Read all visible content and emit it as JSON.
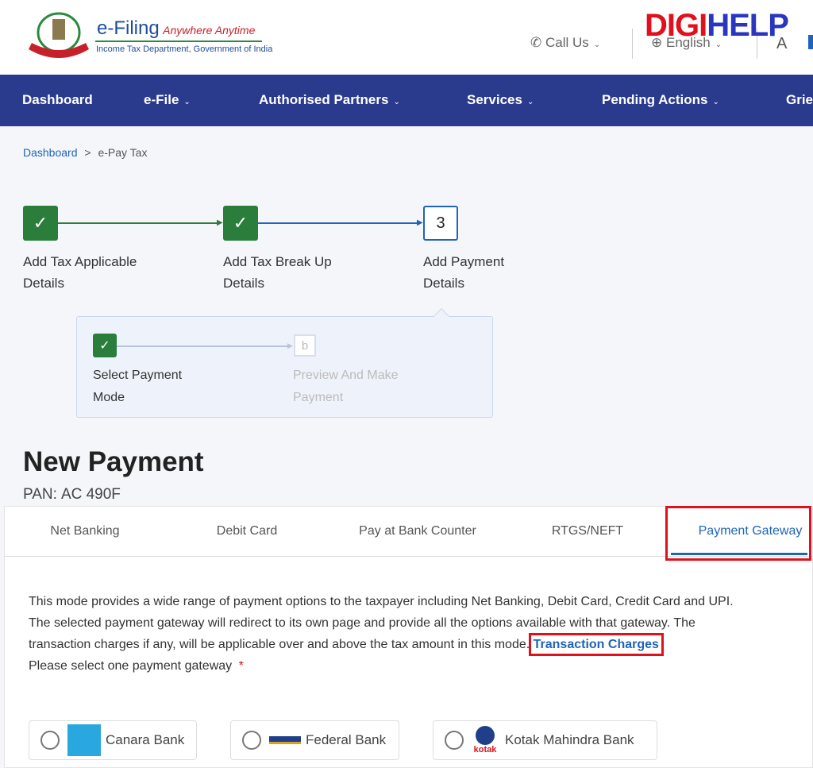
{
  "header": {
    "brand": "e-Filing",
    "tagline": "Anywhere Anytime",
    "subtitle": "Income Tax Department, Government of India",
    "emblem_text": "INCOME TAX DEPARTMENT",
    "call_us": "Call Us",
    "language": "English",
    "font_size": "A",
    "watermark": {
      "part1": "DIGI",
      "part2": "HELP"
    }
  },
  "nav": {
    "items": [
      {
        "label": "Dashboard"
      },
      {
        "label": "e-File"
      },
      {
        "label": "Authorised Partners"
      },
      {
        "label": "Services"
      },
      {
        "label": "Pending Actions"
      },
      {
        "label": "Griev"
      }
    ]
  },
  "breadcrumb": {
    "home": "Dashboard",
    "sep": ">",
    "current": "e-Pay Tax"
  },
  "stepper": {
    "steps": [
      {
        "label": "Add Tax Applicable Details",
        "status": "done"
      },
      {
        "label": "Add Tax Break Up Details",
        "status": "done"
      },
      {
        "label": "Add Payment Details",
        "number": "3",
        "status": "active"
      }
    ],
    "substeps": [
      {
        "label": "Select Payment Mode",
        "status": "done"
      },
      {
        "label": "Preview And Make Payment",
        "marker": "b",
        "status": "pending"
      }
    ]
  },
  "page": {
    "title": "New Payment",
    "pan_label": "PAN:",
    "pan_value": "AC        490F"
  },
  "tabs": [
    {
      "label": "Net Banking"
    },
    {
      "label": "Debit Card"
    },
    {
      "label": "Pay at Bank Counter"
    },
    {
      "label": "RTGS/NEFT"
    },
    {
      "label": "Payment Gateway",
      "active": true
    }
  ],
  "content": {
    "description": "This mode provides a wide range of payment options to the taxpayer including Net Banking, Debit Card, Credit Card and UPI. The selected payment gateway will redirect to its own page and provide all the options available with that gateway. The transaction charges if any, will be applicable over and above the tax amount in this mode.",
    "link": "Transaction Charges",
    "prompt": "Please select one payment gateway",
    "required": "*"
  },
  "banks": [
    {
      "name": "Canara Bank",
      "logo": "canara-bank-logo"
    },
    {
      "name": "Federal Bank",
      "logo": "federal-bank-logo"
    },
    {
      "name": "Kotak Mahindra Bank",
      "logo": "kotak-logo",
      "logo_text": "kotak"
    }
  ],
  "colors": {
    "nav": "#2a3a8c",
    "done": "#2b7d3c",
    "active": "#1f64b8",
    "highlight": "#e0101c"
  }
}
